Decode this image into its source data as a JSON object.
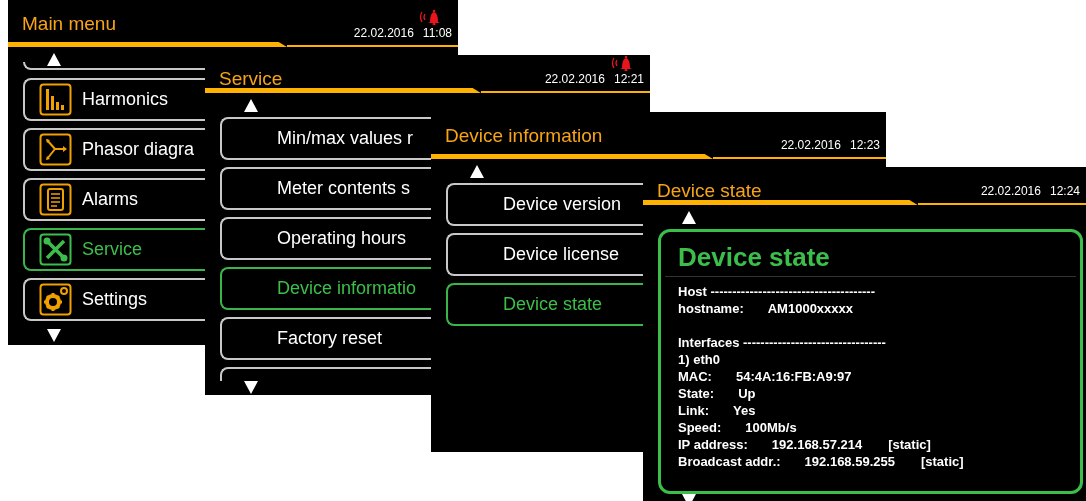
{
  "screens": [
    {
      "kind": "menu",
      "title": "Main menu",
      "date": "22.02.2016",
      "time": "11:08",
      "alarm": true,
      "scroll_up": true,
      "scroll_down": true,
      "clipped_top_item": true,
      "items": [
        {
          "label": "Harmonics",
          "kind": "harmonics",
          "selected": false
        },
        {
          "label": "Phasor diagra",
          "kind": "phasor",
          "selected": false
        },
        {
          "label": "Alarms",
          "kind": "alarms",
          "selected": false
        },
        {
          "label": "Service",
          "kind": "service",
          "selected": true
        },
        {
          "label": "Settings",
          "kind": "settings",
          "selected": false
        }
      ]
    },
    {
      "kind": "menu",
      "title": "Service",
      "date": "22.02.2016",
      "time": "12:21",
      "alarm": true,
      "scroll_up": true,
      "scroll_down": true,
      "clipped_bottom_item": true,
      "items": [
        {
          "label": "Min/max values r",
          "selected": false
        },
        {
          "label": "Meter contents s",
          "selected": false
        },
        {
          "label": "Operating hours",
          "selected": false
        },
        {
          "label": "Device informatio",
          "selected": true
        },
        {
          "label": "Factory reset",
          "selected": false
        }
      ]
    },
    {
      "kind": "menu",
      "title": "Device information",
      "date": "22.02.2016",
      "time": "12:23",
      "scroll_up": true,
      "items": [
        {
          "label": "Device version",
          "selected": false
        },
        {
          "label": "Device license",
          "selected": false
        },
        {
          "label": "Device state",
          "selected": true
        }
      ]
    },
    {
      "kind": "info",
      "title": "Device state",
      "date": "22.02.2016",
      "time": "12:24",
      "scroll_up": true,
      "scroll_down": true,
      "panel": {
        "heading": "Device state",
        "lines": [
          {
            "kind": "heading",
            "text": "Host --------------------------------------"
          },
          {
            "kind": "field",
            "label": "hostname:",
            "value": "AM1000xxxxx"
          },
          {
            "kind": "gap"
          },
          {
            "kind": "heading",
            "text": "Interfaces ---------------------------------"
          },
          {
            "kind": "heading",
            "text": "1) eth0"
          },
          {
            "kind": "field",
            "label": "MAC:",
            "value": "54:4A:16:FB:A9:97"
          },
          {
            "kind": "field",
            "label": "State:",
            "value": "Up"
          },
          {
            "kind": "field",
            "label": "Link:",
            "value": "Yes"
          },
          {
            "kind": "field",
            "label": "Speed:",
            "value": "100Mb/s"
          },
          {
            "kind": "field",
            "label": "IP address:",
            "value": "192.168.57.214",
            "tag": "[static]"
          },
          {
            "kind": "field",
            "label": "Broadcast addr.:",
            "value": "192.168.59.255",
            "tag": "[static]"
          }
        ]
      }
    }
  ]
}
